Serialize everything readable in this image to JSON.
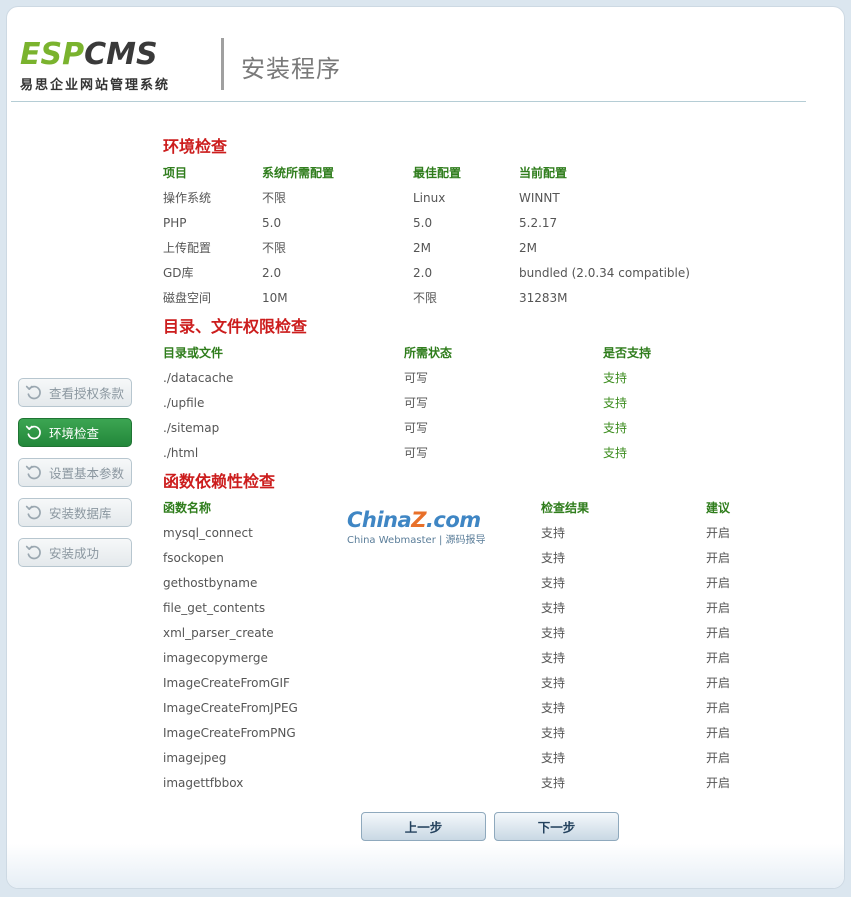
{
  "header": {
    "logo_esp": "ESP",
    "logo_cms": "CMS",
    "logo_subtitle": "易思企业网站管理系统",
    "title": "安装程序"
  },
  "sidebar": {
    "items": [
      {
        "label": "查看授权条款",
        "active": false
      },
      {
        "label": "环境检查",
        "active": true
      },
      {
        "label": "设置基本参数",
        "active": false
      },
      {
        "label": "安装数据库",
        "active": false
      },
      {
        "label": "安装成功",
        "active": false
      }
    ]
  },
  "env": {
    "title": "环境检查",
    "headers": [
      "项目",
      "系统所需配置",
      "最佳配置",
      "当前配置"
    ],
    "rows": [
      [
        "操作系统",
        "不限",
        "Linux",
        "WINNT"
      ],
      [
        "PHP",
        "5.0",
        "5.0",
        "5.2.17"
      ],
      [
        "上传配置",
        "不限",
        "2M",
        "2M"
      ],
      [
        "GD库",
        "2.0",
        "2.0",
        "bundled (2.0.34 compatible)"
      ],
      [
        "磁盘空间",
        "10M",
        "不限",
        "31283M"
      ]
    ]
  },
  "perm": {
    "title": "目录、文件权限检查",
    "headers": [
      "目录或文件",
      "所需状态",
      "是否支持"
    ],
    "rows": [
      [
        "./datacache",
        "可写",
        "支持"
      ],
      [
        "./upfile",
        "可写",
        "支持"
      ],
      [
        "./sitemap",
        "可写",
        "支持"
      ],
      [
        "./html",
        "可写",
        "支持"
      ]
    ]
  },
  "func": {
    "title": "函数依赖性检查",
    "headers": [
      "函数名称",
      "检查结果",
      "建议"
    ],
    "rows": [
      [
        "mysql_connect",
        "支持",
        "开启"
      ],
      [
        "fsockopen",
        "支持",
        "开启"
      ],
      [
        "gethostbyname",
        "支持",
        "开启"
      ],
      [
        "file_get_contents",
        "支持",
        "开启"
      ],
      [
        "xml_parser_create",
        "支持",
        "开启"
      ],
      [
        "imagecopymerge",
        "支持",
        "开启"
      ],
      [
        "ImageCreateFromGIF",
        "支持",
        "开启"
      ],
      [
        "ImageCreateFromJPEG",
        "支持",
        "开启"
      ],
      [
        "ImageCreateFromPNG",
        "支持",
        "开启"
      ],
      [
        "imagejpeg",
        "支持",
        "开启"
      ],
      [
        "imagettfbbox",
        "支持",
        "开启"
      ]
    ]
  },
  "watermark": {
    "main_a": "China",
    "main_z": "Z",
    "main_b": ".com",
    "sub": "China Webmaster | 源码报导"
  },
  "nav": {
    "prev_label": "上一步",
    "next_label": "下一步"
  },
  "colors": {
    "accent_green": "#2f7d1c",
    "section_red": "#cc1d1d",
    "active_button": "#2a9444"
  }
}
